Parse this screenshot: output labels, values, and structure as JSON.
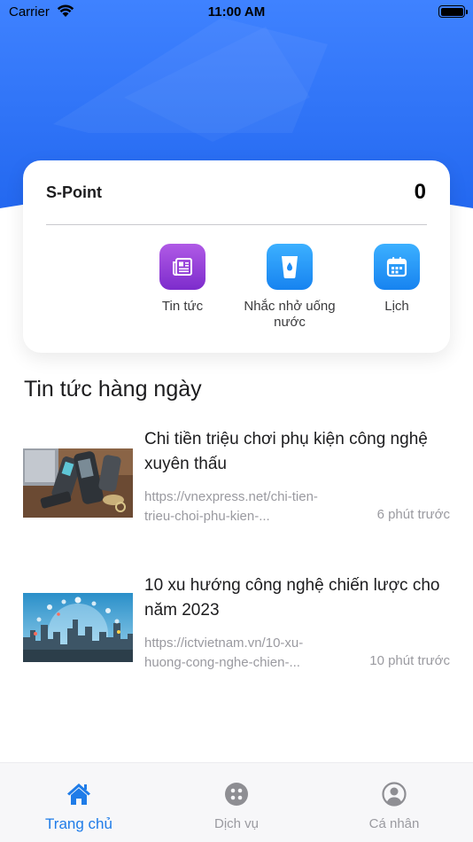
{
  "status_bar": {
    "carrier": "Carrier",
    "time": "11:00 AM"
  },
  "colors": {
    "primary": "#1f7ce8",
    "hero_top": "#3f82ff",
    "hero_bottom": "#2368f0",
    "news_icon": "#8e3bd9",
    "water_icon": "#22a0ff",
    "calendar_icon": "#22a0ff"
  },
  "card": {
    "points_label": "S-Point",
    "points_value": "0",
    "shortcuts": [
      {
        "icon": "newspaper-icon",
        "label": "Tin tức"
      },
      {
        "icon": "water-glass-icon",
        "label": "Nhắc nhở uống nước"
      },
      {
        "icon": "calendar-icon",
        "label": "Lịch"
      }
    ]
  },
  "news_section": {
    "title": "Tin tức hàng ngày",
    "items": [
      {
        "title": "Chi tiền triệu chơi phụ kiện công nghệ xuyên thấu",
        "url": "https://vnexpress.net/chi-tien-trieu-choi-phu-kien-...",
        "time": "6 phút trước",
        "image": "tech-accessories-photo"
      },
      {
        "title": "10 xu hướng công nghệ chiến lược cho năm 2023",
        "url": "https://ictvietnam.vn/10-xu-huong-cong-nghe-chien-...",
        "time": "10 phút trước",
        "image": "city-network-photo"
      }
    ]
  },
  "tab_bar": {
    "tabs": [
      {
        "label": "Trang chủ",
        "icon": "home-icon",
        "active": true
      },
      {
        "label": "Dịch vụ",
        "icon": "services-icon",
        "active": false
      },
      {
        "label": "Cá nhân",
        "icon": "profile-icon",
        "active": false
      }
    ]
  }
}
